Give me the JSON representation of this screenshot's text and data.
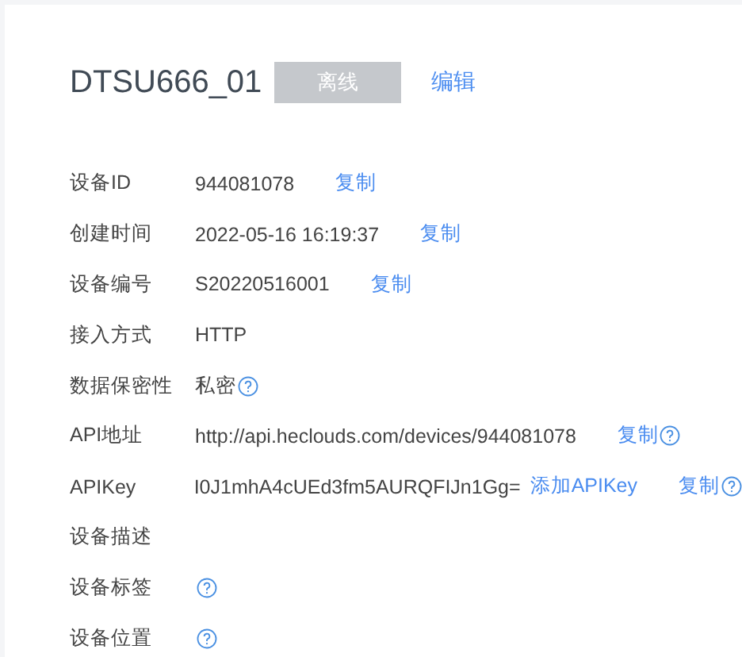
{
  "device": {
    "name": "DTSU666_01",
    "status": "离线",
    "edit": "编辑"
  },
  "rows": [
    {
      "label": "设备ID",
      "value": "944081078",
      "actions": [
        "复制"
      ],
      "help": false
    },
    {
      "label": "创建时间",
      "value": "2022-05-16 16:19:37",
      "actions": [
        "复制"
      ],
      "help": false
    },
    {
      "label": "设备编号",
      "value": "S20220516001",
      "actions": [
        "复制"
      ],
      "help": false
    },
    {
      "label": "接入方式",
      "value": "HTTP",
      "actions": [],
      "help": false
    },
    {
      "label": "数据保密性",
      "value": "私密",
      "actions": [],
      "help": true
    },
    {
      "label": "API地址",
      "value": "http://api.heclouds.com/devices/944081078",
      "actions": [
        "复制"
      ],
      "help": true
    },
    {
      "label": "APIKey",
      "value": "I0J1mhA4cUEd3fm5AURQFIJn1Gg=",
      "actions": [
        "添加APIKey",
        "复制"
      ],
      "help": true
    },
    {
      "label": "设备描述",
      "actions": [],
      "help": false
    },
    {
      "label": "设备标签",
      "actions": [],
      "help": true
    },
    {
      "label": "设备位置",
      "actions": [],
      "help": true
    }
  ]
}
